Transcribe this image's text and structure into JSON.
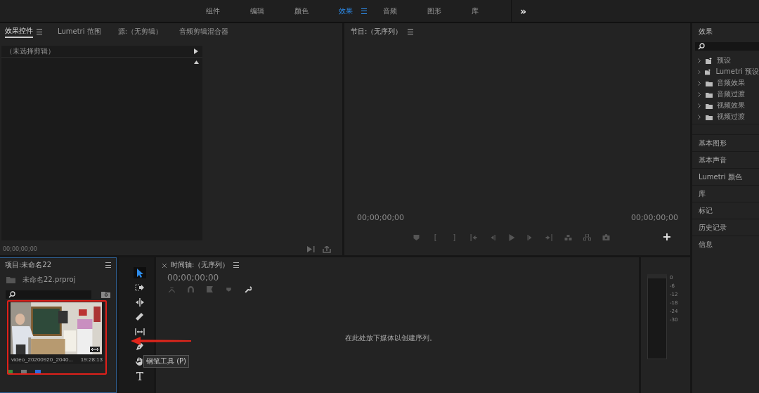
{
  "workspaces": [
    {
      "label": "组件",
      "selected": false
    },
    {
      "label": "编辑",
      "selected": false
    },
    {
      "label": "颜色",
      "selected": false
    },
    {
      "label": "效果",
      "selected": true
    },
    {
      "label": "音频",
      "selected": false
    },
    {
      "label": "图形",
      "selected": false
    },
    {
      "label": "库",
      "selected": false
    }
  ],
  "overflow": "»",
  "effect_controls": {
    "tabs": [
      {
        "label": "效果控件",
        "selected": true
      },
      {
        "label": "Lumetri 范围",
        "selected": false
      },
      {
        "label": "源:（无剪辑）",
        "selected": false
      },
      {
        "label": "音频剪辑混合器",
        "selected": false
      }
    ],
    "clip_label": "（未选择剪辑）",
    "timecode": "00;00;00;00"
  },
  "program": {
    "title": "节目:（无序列）",
    "timecode_left": "00;00;00;00",
    "timecode_right": "00;00;00;00"
  },
  "effects_panel": {
    "title": "效果",
    "tree": [
      {
        "label": "预设",
        "kind": "preset"
      },
      {
        "label": "Lumetri 预设",
        "kind": "preset"
      },
      {
        "label": "音频效果",
        "kind": "folder"
      },
      {
        "label": "音频过渡",
        "kind": "folder"
      },
      {
        "label": "视频效果",
        "kind": "folder"
      },
      {
        "label": "视频过渡",
        "kind": "folder"
      }
    ],
    "panels": [
      "基本图形",
      "基本声音",
      "Lumetri 颜色",
      "库",
      "标记",
      "历史记录",
      "信息"
    ]
  },
  "project": {
    "title": "项目:未命名22",
    "file": "未命名22.prproj",
    "clip": {
      "name": "video_20200920_2040...",
      "duration": "19:28:13",
      "highlighted": true
    }
  },
  "tools": [
    {
      "kind": "selection",
      "selected": true
    },
    {
      "kind": "track-select",
      "selected": false
    },
    {
      "kind": "ripple",
      "selected": false
    },
    {
      "kind": "razor",
      "selected": false
    },
    {
      "kind": "slip",
      "selected": false
    },
    {
      "kind": "pen",
      "selected": false
    },
    {
      "kind": "hand",
      "selected": false
    },
    {
      "kind": "type",
      "selected": false
    }
  ],
  "tooltip": "钢笔工具 (P)",
  "timeline": {
    "title": "时间轴:（无序列）",
    "timecode": "00;00;00;00",
    "message": "在此处放下媒体以创建序列。"
  },
  "meter": {
    "ticks": [
      "0",
      "-6",
      "-12",
      "-18",
      "-24",
      "-30"
    ]
  }
}
